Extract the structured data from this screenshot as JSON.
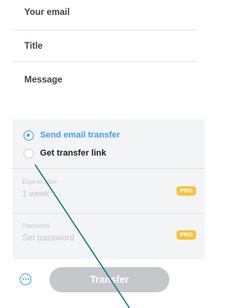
{
  "form": {
    "email_placeholder": "Your email",
    "title_placeholder": "Title",
    "message_placeholder": "Message"
  },
  "transfer_options": {
    "send_email": {
      "label": "Send email transfer",
      "selected": true
    },
    "get_link": {
      "label": "Get transfer link",
      "selected": false
    }
  },
  "settings": {
    "expire": {
      "label": "Expires after",
      "value": "1 week",
      "badge": "PRO"
    },
    "password": {
      "label": "Password",
      "placeholder": "Set password",
      "badge": "PRO"
    }
  },
  "actions": {
    "more_icon": "more-dots-icon",
    "transfer_label": "Transfer"
  },
  "colors": {
    "accent": "#409fff",
    "pro_badge": "#f8c23c",
    "button_disabled": "#c6c7ca",
    "annotation_line": "#177e8e"
  }
}
